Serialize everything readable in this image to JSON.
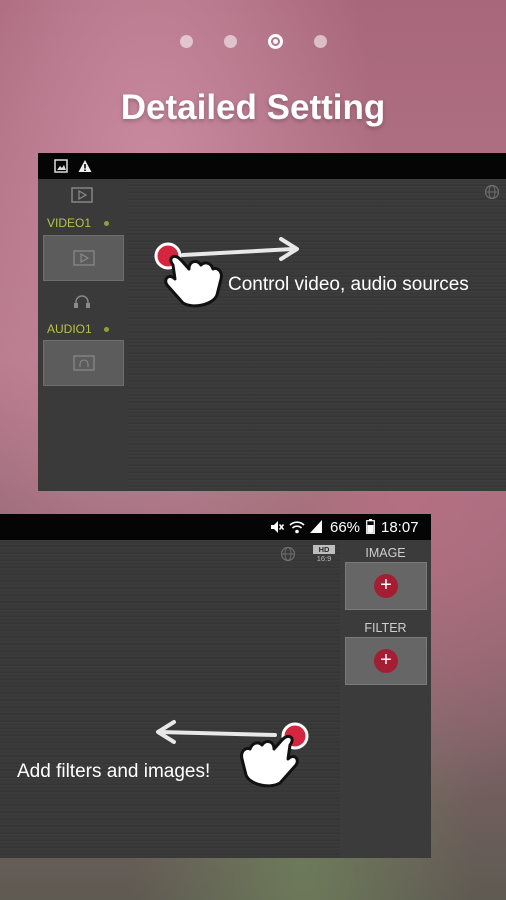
{
  "pager": {
    "count": 4,
    "active_index": 2
  },
  "title": "Detailed Setting",
  "screen1": {
    "sources": [
      {
        "label": "VIDEO1"
      },
      {
        "label": "AUDIO1"
      }
    ],
    "callout": "Control video, audio sources"
  },
  "screen2": {
    "status": {
      "battery": "66%",
      "time": "18:07"
    },
    "badge": {
      "top": "HD",
      "bottom": "16:9"
    },
    "panels": [
      {
        "label": "IMAGE",
        "button": "+"
      },
      {
        "label": "FILTER",
        "button": "+"
      }
    ],
    "callout": "Add filters and images!"
  },
  "colors": {
    "accent_red": "#a31d33",
    "source_green": "#b7c24f"
  }
}
